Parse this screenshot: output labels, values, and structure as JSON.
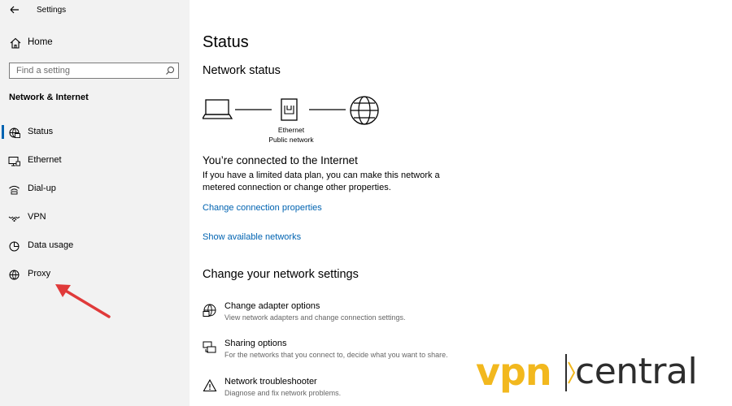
{
  "window": {
    "title": "Settings"
  },
  "sidebar": {
    "home_label": "Home",
    "search_placeholder": "Find a setting",
    "section_title": "Network & Internet",
    "items": [
      {
        "label": "Status",
        "icon": "status-globe-icon",
        "selected": true
      },
      {
        "label": "Ethernet",
        "icon": "ethernet-icon",
        "selected": false
      },
      {
        "label": "Dial-up",
        "icon": "dial-up-icon",
        "selected": false
      },
      {
        "label": "VPN",
        "icon": "vpn-icon",
        "selected": false
      },
      {
        "label": "Data usage",
        "icon": "data-usage-icon",
        "selected": false
      },
      {
        "label": "Proxy",
        "icon": "globe-icon",
        "selected": false
      }
    ]
  },
  "main": {
    "title": "Status",
    "network_status_heading": "Network status",
    "diagram": {
      "adapter_name": "Ethernet",
      "network_type": "Public network"
    },
    "connected_text": "You’re connected to the Internet",
    "description": "If you have a limited data plan, you can make this network a metered connection or change other properties.",
    "links": {
      "change_connection": "Change connection properties",
      "show_networks": "Show available networks"
    },
    "change_heading": "Change your network settings",
    "options": [
      {
        "title": "Change adapter options",
        "subtitle": "View network adapters and change connection settings.",
        "icon": "adapter-globe-icon"
      },
      {
        "title": "Sharing options",
        "subtitle": "For the networks that you connect to, decide what you want to share.",
        "icon": "sharing-icon"
      },
      {
        "title": "Network troubleshooter",
        "subtitle": "Diagnose and fix network problems.",
        "icon": "warning-icon"
      }
    ]
  },
  "watermark": {
    "part1": "vpn",
    "part2": "central"
  },
  "colors": {
    "accent": "#0063b1",
    "sidebar_bg": "#f2f2f2",
    "annotation_arrow": "#e03a3a",
    "watermark_yellow": "#f2b81e"
  }
}
